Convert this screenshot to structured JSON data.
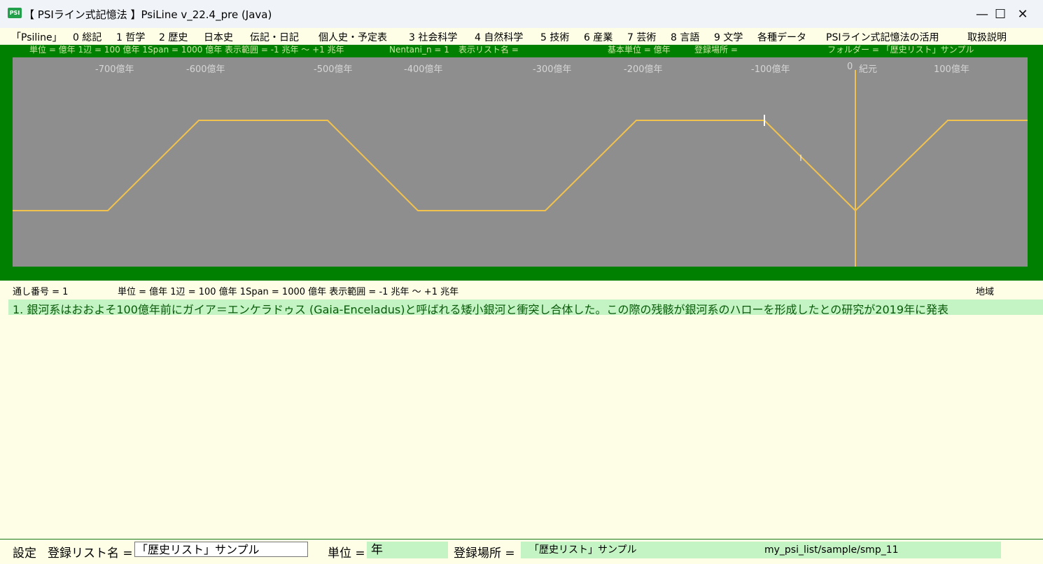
{
  "window": {
    "icon_text": "PSI",
    "title": "【 PSIライン式記憶法 】PsiLine v_22.4_pre (Java)",
    "minimize": "—",
    "maximize": "☐",
    "close": "✕"
  },
  "menu": {
    "items": [
      "「Psiline」",
      "0 総記",
      "1 哲学",
      "2 歴史",
      "日本史",
      "伝記・日記",
      "個人史・予定表",
      "3 社会科学",
      "4 自然科学",
      "5 技術",
      "6 産業",
      "7 芸術",
      "8 言語",
      "9 文学",
      "各種データ",
      "PSIライン式記憶法の活用",
      "取扱説明"
    ]
  },
  "status": {
    "unit_info": "単位 = 億年  1辺 = 100 億年  1Span = 1000 億年  表示範囲 = -1 兆年 〜 +1 兆年",
    "nentani": "Nentani_n = 1",
    "display_list": "表示リスト名 =",
    "base_unit": "基本単位 = 億年",
    "registration_place": "登録場所 =",
    "folder": "フォルダー = 「歴史リスト」サンプル"
  },
  "chart_data": {
    "type": "line",
    "axis_labels": [
      "-700億年",
      "-600億年",
      "-500億年",
      "-400億年",
      "-300億年",
      "-200億年",
      "-100億年",
      "0",
      "紀元",
      "100億年"
    ],
    "line_color": "#f2c24e",
    "background": "#8e8e8e"
  },
  "info": {
    "serial": "通し番号 = 1",
    "unit_info": "単位 = 億年  1辺 = 100 億年  1Span = 1000 億年  表示範囲 = -1 兆年 〜 +1 兆年",
    "region": "地域"
  },
  "entry": {
    "text": "1. 銀河系はおおよそ100億年前にガイア＝エンケラドゥス (Gaia-Enceladus)と呼ばれる矮小銀河と衝突し合体した。この際の残骸が銀河系のハローを形成したとの研究が2019年に発表"
  },
  "bottom": {
    "settings": "設定",
    "list_name_label": "登録リスト名 =",
    "list_name_value": "「歴史リスト」サンプル",
    "unit_label": "単位 =",
    "unit_value": "年",
    "place_label": "登録場所 =",
    "place_value": "「歴史リスト」サンプル",
    "path": "my_psi_list/sample/smp_11"
  },
  "colors": {
    "frame_green": "#008000",
    "background_cream": "#fefee6",
    "highlight_green": "#c4f4c4"
  }
}
